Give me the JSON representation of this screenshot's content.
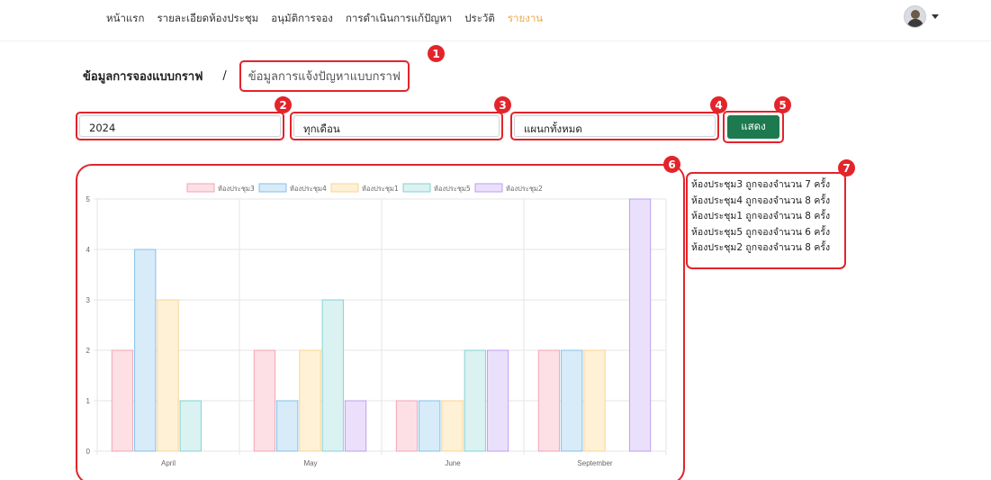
{
  "nav": {
    "items": [
      "หน้าแรก",
      "รายละเอียดห้องประชุม",
      "อนุมัติการจอง",
      "การดำเนินการแก้ปัญหา",
      "ประวัติ",
      "รายงาน"
    ],
    "active_index": 5,
    "active_color": "#f0a94b"
  },
  "breadcrumb": {
    "first": "ข้อมูลการจองแบบกราฟ",
    "separator": "/",
    "current": "ข้อมูลการแจ้งปัญหาแบบกราฟ"
  },
  "filters": {
    "year": "2024",
    "month": "ทุกเดือน",
    "department": "แผนกทั้งหมด",
    "show_button": "แสดง"
  },
  "markers": [
    "1",
    "2",
    "3",
    "4",
    "5",
    "6",
    "7"
  ],
  "summary": {
    "lines": [
      "ห้องประชุม3 ถูกจองจำนวน 7 ครั้ง",
      "ห้องประชุม4 ถูกจองจำนวน 8 ครั้ง",
      "ห้องประชุม1 ถูกจองจำนวน 8 ครั้ง",
      "ห้องประชุม5 ถูกจองจำนวน 6 ครั้ง",
      "ห้องประชุม2 ถูกจองจำนวน 8 ครั้ง"
    ]
  },
  "colors": {
    "accent_red": "#e3242b",
    "button_green": "#1d7a4e"
  },
  "chart_data": {
    "type": "bar",
    "categories": [
      "April",
      "May",
      "June",
      "September"
    ],
    "ylim": [
      0,
      5
    ],
    "yticks": [
      0,
      1,
      2,
      3,
      4,
      5
    ],
    "grid": true,
    "legend_position": "top",
    "series": [
      {
        "name": "ห้องประชุม3",
        "values": [
          2,
          2,
          1,
          2
        ],
        "fill": "#fde0e6",
        "stroke": "#f4a3b3"
      },
      {
        "name": "ห้องประชุม4",
        "values": [
          4,
          1,
          1,
          2
        ],
        "fill": "#d8ebf8",
        "stroke": "#86c1ea"
      },
      {
        "name": "ห้องประชุม1",
        "values": [
          3,
          2,
          1,
          2
        ],
        "fill": "#fff1d6",
        "stroke": "#f9d490"
      },
      {
        "name": "ห้องประชุม5",
        "values": [
          1,
          3,
          2,
          0
        ],
        "fill": "#dbf2f2",
        "stroke": "#86d2d2"
      },
      {
        "name": "ห้องประชุม2",
        "values": [
          0,
          1,
          2,
          5
        ],
        "fill": "#ebe0fb",
        "stroke": "#bd9ef2"
      }
    ]
  }
}
